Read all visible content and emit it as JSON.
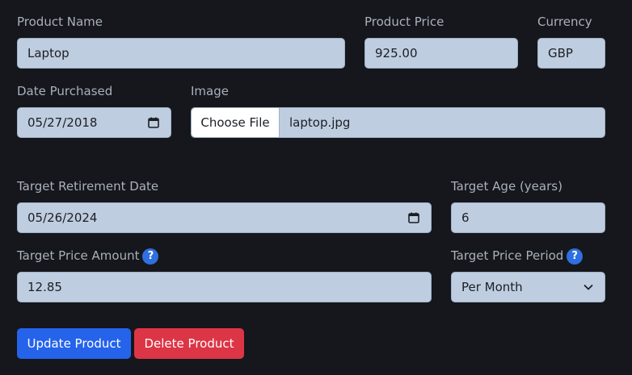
{
  "form": {
    "product_name": {
      "label": "Product Name",
      "value": "Laptop"
    },
    "product_price": {
      "label": "Product Price",
      "value": "925.00"
    },
    "currency": {
      "label": "Currency",
      "value": "GBP"
    },
    "date_purchased": {
      "label": "Date Purchased",
      "value": "05/27/2018"
    },
    "image": {
      "label": "Image",
      "button_label": "Choose File",
      "file_name": "laptop.jpg"
    },
    "target_retirement_date": {
      "label": "Target Retirement Date",
      "value": "05/26/2024"
    },
    "target_age": {
      "label": "Target Age (years)",
      "value": "6"
    },
    "target_price_amount": {
      "label": "Target Price Amount",
      "value": "12.85",
      "help": "?"
    },
    "target_price_period": {
      "label": "Target Price Period",
      "value": "Per Month",
      "help": "?"
    }
  },
  "actions": {
    "update_label": "Update Product",
    "delete_label": "Delete Product"
  },
  "colors": {
    "background": "#15171c",
    "field": "#bfcde0",
    "primary": "#2563eb",
    "danger": "#dc3545",
    "help": "#2f6fe0"
  },
  "icons": {
    "date_picker": "calendar-icon",
    "select": "chevron-down-icon",
    "help": "question-mark-icon"
  }
}
